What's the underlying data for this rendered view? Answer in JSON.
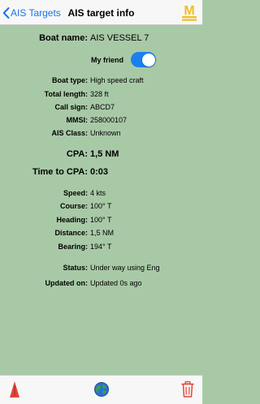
{
  "navbar": {
    "back_label": "AIS Targets",
    "title": "AIS target info",
    "logo_letter": "M"
  },
  "boat": {
    "label": "Boat name:",
    "value": "AIS VESSEL 7"
  },
  "friend": {
    "label": "My friend",
    "on": true
  },
  "details": [
    {
      "label": "Boat type:",
      "value": "High speed craft"
    },
    {
      "label": "Total length:",
      "value": "328 ft"
    },
    {
      "label": "Call sign:",
      "value": "ABCD7"
    },
    {
      "label": "MMSI:",
      "value": "258000107"
    },
    {
      "label": "AIS Class:",
      "value": "Unknown"
    }
  ],
  "cpa": {
    "label": "CPA:",
    "value": "1,5 NM"
  },
  "tcpa": {
    "label": "Time to CPA:",
    "value": "0:03"
  },
  "motion": [
    {
      "label": "Speed:",
      "value": "4 kts"
    },
    {
      "label": "Course:",
      "value": "100° T"
    },
    {
      "label": "Heading:",
      "value": "100° T"
    },
    {
      "label": "Distance:",
      "value": "1,5 NM"
    },
    {
      "label": "Bearing:",
      "value": "194° T"
    }
  ],
  "status": {
    "label": "Status:",
    "value": "Under way using Eng"
  },
  "updated": {
    "label": "Updated on:",
    "value": "Updated 0s ago"
  },
  "toolbar": {
    "icons": [
      "boat-marker-icon",
      "globe-icon",
      "trash-icon"
    ]
  },
  "colors": {
    "background": "#a8c9a6",
    "accent": "#1a7ff0",
    "danger": "#e0453a",
    "logo": "#f0c020"
  }
}
